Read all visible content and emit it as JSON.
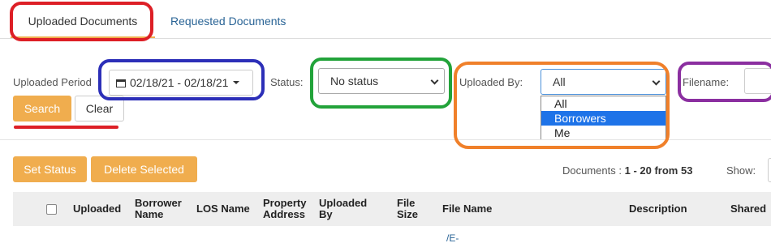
{
  "tabs": {
    "uploaded": "Uploaded Documents",
    "requested": "Requested Documents"
  },
  "filters": {
    "period_label": "Uploaded Period",
    "period_value": "02/18/21 - 02/18/21",
    "status_label": "Status:",
    "status_value": "No status",
    "uploaded_by_label": "Uploaded By:",
    "uploaded_by_value": "All",
    "uploaded_by_options": [
      "All",
      "Borrowers",
      "Me"
    ],
    "uploaded_by_highlighted": "Borrowers",
    "filename_label": "Filename:"
  },
  "buttons": {
    "search": "Search",
    "clear": "Clear",
    "set_status": "Set Status",
    "delete_selected": "Delete Selected"
  },
  "summary": {
    "documents_label": "Documents :",
    "documents_range": "1 - 20 from 53",
    "show_label": "Show:"
  },
  "table": {
    "headers": {
      "uploaded": "Uploaded",
      "borrower_name_1": "Borrower",
      "borrower_name_2": "Name",
      "los_name": "LOS Name",
      "property_address_1": "Property",
      "property_address_2": "Address",
      "uploaded_by_1": "Uploaded",
      "uploaded_by_2": "By",
      "file_size_1": "File",
      "file_size_2": "Size",
      "file_name": "File Name",
      "description": "Description",
      "shared": "Shared"
    },
    "first_row_fragment": "/E-"
  },
  "annotation_colors": {
    "tab": "#dd1f26",
    "period": "#2c2fb8",
    "status": "#22a33a",
    "uploaded_by": "#f0802a",
    "filename": "#8b2fa0",
    "search_underline": "#dd1f26"
  },
  "colors": {
    "accent": "#f0ad4e",
    "link": "#2a6496",
    "option_highlight": "#1e73e8"
  }
}
